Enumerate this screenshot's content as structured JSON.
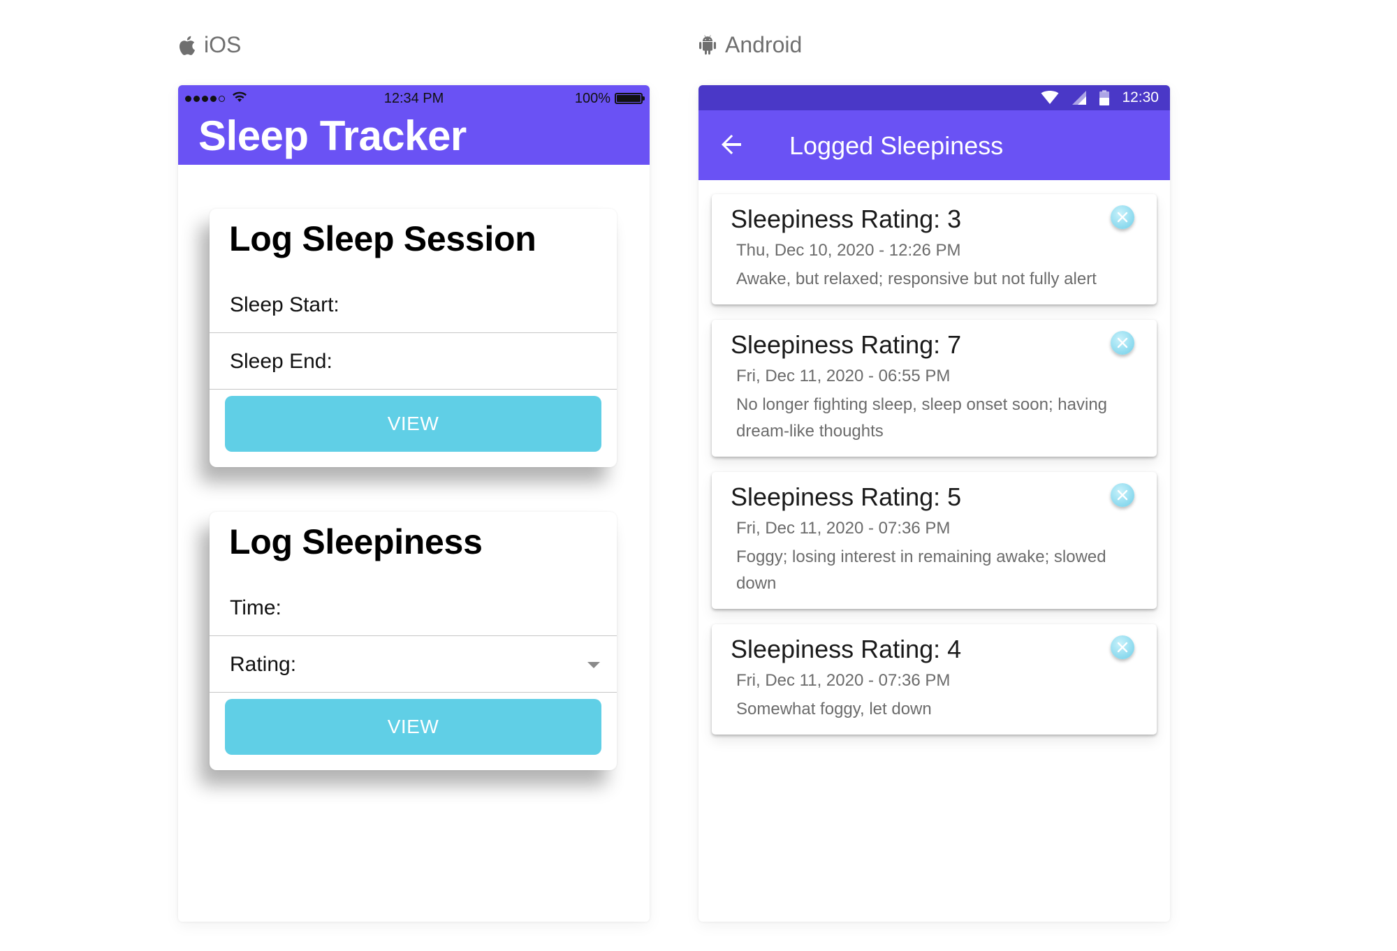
{
  "labels": {
    "ios": "iOS",
    "android": "Android"
  },
  "ios": {
    "status": {
      "time": "12:34 PM",
      "battery": "100%"
    },
    "title": "Sleep Tracker",
    "session_card": {
      "title": "Log Sleep Session",
      "start_label": "Sleep Start:",
      "end_label": "Sleep End:",
      "button": "VIEW"
    },
    "sleepiness_card": {
      "title": "Log Sleepiness",
      "time_label": "Time:",
      "rating_label": "Rating:",
      "button": "VIEW"
    },
    "colors": {
      "header": "#6a52f4",
      "button": "#60cfe6"
    }
  },
  "android": {
    "status": {
      "time": "12:30"
    },
    "title": "Logged Sleepiness",
    "entries": [
      {
        "title": "Sleepiness Rating: 3",
        "date": "Thu, Dec 10, 2020 - 12:26 PM",
        "description": "Awake, but relaxed; responsive but not fully alert"
      },
      {
        "title": "Sleepiness Rating: 7",
        "date": "Fri, Dec 11, 2020 - 06:55 PM",
        "description": "No longer fighting sleep, sleep onset soon; having dream-like thoughts"
      },
      {
        "title": "Sleepiness Rating: 5",
        "date": "Fri, Dec 11, 2020 - 07:36 PM",
        "description": "Foggy; losing interest in remaining awake; slowed down"
      },
      {
        "title": "Sleepiness Rating: 4",
        "date": "Fri, Dec 11, 2020 - 07:36 PM",
        "description": "Somewhat foggy, let down"
      }
    ],
    "colors": {
      "status_bar": "#4a38c7",
      "app_bar": "#6a52f4",
      "close_button": "#8ad9ee"
    }
  },
  "icons": {
    "ios_label": "apple-icon",
    "android_label": "android-icon",
    "back": "back-arrow-icon",
    "close": "close-icon",
    "dropdown": "chevron-down-icon"
  }
}
